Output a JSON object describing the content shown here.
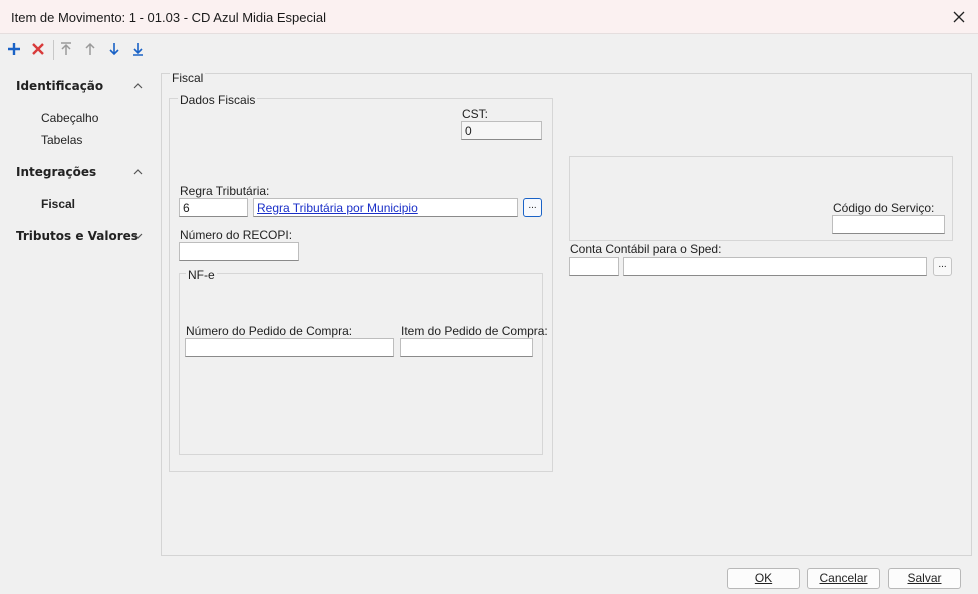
{
  "window": {
    "title": "Item de Movimento: 1 - 01.03 - CD Azul Midia Especial"
  },
  "icons": {
    "add": "plus-icon",
    "delete": "x-icon",
    "first": "arrow-top-icon",
    "up": "arrow-up-icon",
    "down": "arrow-down-icon",
    "last": "arrow-bottom-icon",
    "close": "close-icon",
    "chevron_up": "chevron-up-icon",
    "chevron_down": "chevron-down-icon"
  },
  "sidebar": {
    "identificacao": {
      "label": "Identificação",
      "items": [
        "Cabeçalho",
        "Tabelas"
      ]
    },
    "integracoes": {
      "label": "Integrações",
      "items": [
        "Fiscal"
      ]
    },
    "tributos": {
      "label": "Tributos e Valores"
    }
  },
  "main": {
    "group_title": "Fiscal",
    "dados_fiscais": {
      "title": "Dados Fiscais",
      "cst": {
        "label": "CST:",
        "value": "0"
      },
      "regra": {
        "label": "Regra Tributária:",
        "code": "6",
        "link": "Regra Tributária por Municipio",
        "button": "..."
      },
      "recopi": {
        "label": "Número do RECOPI:",
        "value": ""
      },
      "nfe": {
        "title": "NF-e",
        "pedido": {
          "label": "Número do Pedido de Compra:",
          "value": ""
        },
        "item": {
          "label": "Item do Pedido de Compra:",
          "value": ""
        }
      }
    },
    "codigo_servico": {
      "label": "Código do Serviço:",
      "value": ""
    },
    "conta_contabil": {
      "label": "Conta Contábil para o Sped:",
      "code": "",
      "desc": "",
      "button": "..."
    }
  },
  "footer": {
    "ok": "OK",
    "cancel": "Cancelar",
    "save": "Salvar"
  },
  "colors": {
    "accent": "#1a62c6",
    "delete": "#d83b3b",
    "link": "#1a2fc8",
    "titlebar_bg": "#fbf1f1"
  }
}
